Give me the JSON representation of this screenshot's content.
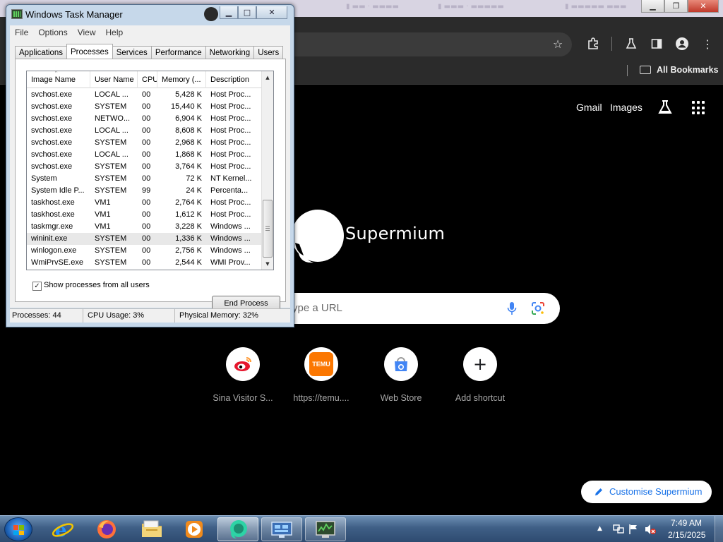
{
  "browser": {
    "bookmarks_label": "All Bookmarks",
    "links": {
      "gmail": "Gmail",
      "images": "Images"
    },
    "brand": "Supermium",
    "search_placeholder": "ype a URL",
    "shortcuts": [
      {
        "label": "Sina Visitor S...",
        "icon": "weibo-icon"
      },
      {
        "label": "https://temu....",
        "icon": "temu-icon",
        "icon_text": "TEMU"
      },
      {
        "label": "Web Store",
        "icon": "web-store-icon"
      },
      {
        "label": "Add shortcut",
        "icon": "plus-icon",
        "icon_text": "+"
      }
    ],
    "customise_label": "Customise Supermium",
    "colors": {
      "background": "#000000",
      "toolbar": "#2b2b2b",
      "accent": "#1a73e8"
    }
  },
  "task_manager": {
    "title": "Windows Task Manager",
    "menu": [
      "File",
      "Options",
      "View",
      "Help"
    ],
    "tabs": [
      "Applications",
      "Processes",
      "Services",
      "Performance",
      "Networking",
      "Users"
    ],
    "active_tab": "Processes",
    "columns": [
      "Image Name",
      "User Name",
      "CPU",
      "Memory (...",
      "Description"
    ],
    "rows": [
      [
        "svchost.exe",
        "LOCAL ...",
        "00",
        "5,428 K",
        "Host Proc..."
      ],
      [
        "svchost.exe",
        "SYSTEM",
        "00",
        "15,440 K",
        "Host Proc..."
      ],
      [
        "svchost.exe",
        "NETWO...",
        "00",
        "6,904 K",
        "Host Proc..."
      ],
      [
        "svchost.exe",
        "LOCAL ...",
        "00",
        "8,608 K",
        "Host Proc..."
      ],
      [
        "svchost.exe",
        "SYSTEM",
        "00",
        "2,968 K",
        "Host Proc..."
      ],
      [
        "svchost.exe",
        "LOCAL ...",
        "00",
        "1,868 K",
        "Host Proc..."
      ],
      [
        "svchost.exe",
        "SYSTEM",
        "00",
        "3,764 K",
        "Host Proc..."
      ],
      [
        "System",
        "SYSTEM",
        "00",
        "72 K",
        "NT Kernel..."
      ],
      [
        "System Idle P...",
        "SYSTEM",
        "99",
        "24 K",
        "Percenta..."
      ],
      [
        "taskhost.exe",
        "VM1",
        "00",
        "2,764 K",
        "Host Proc..."
      ],
      [
        "taskhost.exe",
        "VM1",
        "00",
        "1,612 K",
        "Host Proc..."
      ],
      [
        "taskmgr.exe",
        "VM1",
        "00",
        "3,228 K",
        "Windows ..."
      ],
      [
        "wininit.exe",
        "SYSTEM",
        "00",
        "1,336 K",
        "Windows ..."
      ],
      [
        "winlogon.exe",
        "SYSTEM",
        "00",
        "2,756 K",
        "Windows ..."
      ],
      [
        "WmiPrvSE.exe",
        "SYSTEM",
        "00",
        "2,544 K",
        "WMI Prov..."
      ]
    ],
    "selected_row": "wininit.exe",
    "show_all_label": "Show processes from all users",
    "show_all_checked": "✓",
    "end_process_label": "End Process",
    "status": [
      "Processes: 44",
      "CPU Usage: 3%",
      "Physical Memory: 32%"
    ]
  },
  "taskbar": {
    "pinned": [
      "start-orb",
      "internet-explorer-icon",
      "firefox-icon",
      "explorer-folder-icon",
      "media-player-icon",
      "supermium-icon",
      "remote-desktop-icon",
      "task-manager-icon"
    ],
    "time": "7:49 AM",
    "date": "2/15/2025"
  }
}
